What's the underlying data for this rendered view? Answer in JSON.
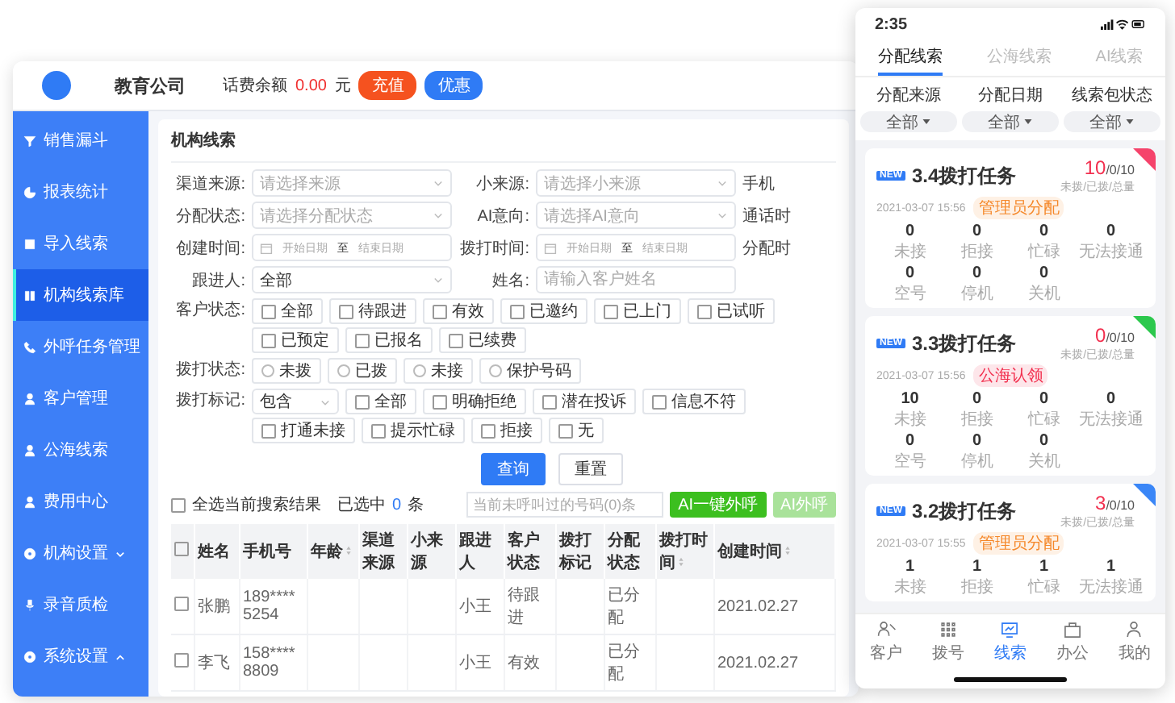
{
  "header": {
    "company": "教育公司",
    "balance_label": "话费余额",
    "balance": "0.00",
    "currency": "元",
    "buttons": [
      {
        "label": "充值",
        "kind": "recharge"
      },
      {
        "label": "优惠",
        "kind": "promo"
      }
    ]
  },
  "sidebar": {
    "items": [
      {
        "label": "销售漏斗",
        "selected": false
      },
      {
        "label": "报表统计",
        "selected": false
      },
      {
        "label": "导入线索",
        "selected": false
      },
      {
        "label": "机构线索库",
        "selected": true
      },
      {
        "label": "外呼任务管理",
        "selected": false
      },
      {
        "label": "客户管理",
        "selected": false
      },
      {
        "label": "公海线索",
        "selected": false
      },
      {
        "label": "费用中心",
        "selected": false
      },
      {
        "label": "机构设置",
        "selected": false,
        "expanded": false
      },
      {
        "label": "录音质检",
        "selected": false
      },
      {
        "label": "系统设置",
        "selected": false,
        "expanded": true
      }
    ]
  },
  "panel": {
    "title": "机构线索",
    "fields": [
      [
        {
          "label": "渠道来源:",
          "kind": "select",
          "placeholder": "请选择来源"
        },
        {
          "label": "小来源:",
          "kind": "select",
          "placeholder": "请选择小来源"
        },
        {
          "label": "手机",
          "kind": "cut"
        }
      ],
      [
        {
          "label": "分配状态:",
          "kind": "select",
          "placeholder": "请选择分配状态"
        },
        {
          "label": "AI意向:",
          "kind": "select",
          "placeholder": "请选择AI意向"
        },
        {
          "label": "通话时",
          "kind": "cut"
        }
      ],
      [
        {
          "label": "创建时间:",
          "kind": "date",
          "start": "开始日期",
          "sep": "至",
          "end": "结束日期"
        },
        {
          "label": "拨打时间:",
          "kind": "date",
          "start": "开始日期",
          "sep": "至",
          "end": "结束日期"
        },
        {
          "label": "分配时",
          "kind": "cut"
        }
      ],
      [
        {
          "label": "跟进人:",
          "kind": "select",
          "value": "全部"
        },
        {
          "label": "姓名:",
          "kind": "input",
          "placeholder": "请输入客户姓名"
        }
      ]
    ],
    "options": [
      {
        "label": "客户状态:",
        "kind": "checkbox",
        "options": [
          {
            "label": "全部",
            "checked": false
          },
          {
            "label": "待跟进",
            "checked": false
          },
          {
            "label": "有效",
            "checked": false
          },
          {
            "label": "已邀约",
            "checked": false
          },
          {
            "label": "已上门",
            "checked": false
          },
          {
            "label": "已试听",
            "checked": false
          },
          {
            "label": "已预定",
            "checked": false
          },
          {
            "label": "已报名",
            "checked": false
          },
          {
            "label": "已续费",
            "checked": false
          }
        ]
      },
      {
        "label": "拨打状态:",
        "kind": "radio",
        "options": [
          {
            "label": "未拨",
            "selected": false
          },
          {
            "label": "已拨",
            "selected": false
          },
          {
            "label": "未接",
            "selected": false
          },
          {
            "label": "保护号码",
            "selected": false
          }
        ]
      },
      {
        "label": "拨打标记:",
        "kind": "checkbox",
        "select": "包含",
        "options": [
          {
            "label": "全部",
            "checked": false
          },
          {
            "label": "明确拒绝",
            "checked": false
          },
          {
            "label": "潜在投诉",
            "checked": false
          },
          {
            "label": "信息不符",
            "checked": false
          },
          {
            "label": "打通未接",
            "checked": false
          },
          {
            "label": "提示忙碌",
            "checked": false
          },
          {
            "label": "拒接",
            "checked": false
          },
          {
            "label": "无",
            "checked": false
          }
        ]
      }
    ],
    "actions": [
      {
        "label": "查询",
        "kind": "primary"
      },
      {
        "label": "重置",
        "kind": "default"
      }
    ],
    "selection": {
      "checked": false,
      "label": "全选当前搜索结果",
      "count_label": "已选中",
      "count": "0",
      "unit": "条"
    },
    "call_tools": {
      "placeholder": "当前未呼叫过的号码(0)条",
      "buttons": [
        {
          "label": "AI一键外呼",
          "disabled": false
        },
        {
          "label": "AI外呼",
          "disabled": true
        }
      ]
    },
    "table": {
      "all_checked": false,
      "columns": [
        {
          "label": "姓名",
          "sortable": false
        },
        {
          "label": "手机号",
          "sortable": false
        },
        {
          "label": "年龄",
          "sortable": true
        },
        {
          "label": "渠道来源",
          "sortable": false
        },
        {
          "label": "小来源",
          "sortable": false
        },
        {
          "label": "跟进人",
          "sortable": false
        },
        {
          "label": "客户状态",
          "sortable": false
        },
        {
          "label": "拨打标记",
          "sortable": false
        },
        {
          "label": "分配状态",
          "sortable": false
        },
        {
          "label": "拨打时间",
          "sortable": true
        },
        {
          "label": "创建时间",
          "sortable": true
        }
      ],
      "rows": [
        {
          "checked": false,
          "cells": [
            "张鹏",
            "189****5254",
            "",
            "",
            "",
            "小王",
            "待跟进",
            "",
            "已分配",
            "",
            "2021.02.27"
          ]
        },
        {
          "checked": false,
          "cells": [
            "李飞",
            "158****8809",
            "",
            "",
            "",
            "小王",
            "有效",
            "",
            "已分配",
            "",
            "2021.02.27"
          ]
        }
      ]
    }
  },
  "phone": {
    "time": "2:35",
    "tabs": [
      {
        "label": "分配线索",
        "selected": true
      },
      {
        "label": "公海线索",
        "selected": false
      },
      {
        "label": "AI线索",
        "selected": false
      }
    ],
    "filters": [
      {
        "label": "分配来源",
        "value": "全部"
      },
      {
        "label": "分配日期",
        "value": "全部"
      },
      {
        "label": "线索包状态",
        "value": "全部"
      }
    ],
    "cards": [
      {
        "badge": "NEW",
        "title": "3.4拨打任务",
        "done": "10",
        "rest": "/0/10",
        "legend": "未拨/已拨/总量",
        "date": "2021-03-07 15:56",
        "tag": {
          "label": "管理员分配",
          "color": "#f5882a"
        },
        "color": "#f5436b",
        "stats": [
          {
            "value": "0",
            "label": "未接"
          },
          {
            "value": "0",
            "label": "拒接"
          },
          {
            "value": "0",
            "label": "忙碌"
          },
          {
            "value": "0",
            "label": "无法接通"
          },
          {
            "value": "0",
            "label": "空号"
          },
          {
            "value": "0",
            "label": "停机"
          },
          {
            "value": "0",
            "label": "关机"
          }
        ]
      },
      {
        "badge": "NEW",
        "title": "3.3拨打任务",
        "done": "0",
        "rest": "/0/10",
        "legend": "未拨/已拨/总量",
        "date": "2021-03-07 15:56",
        "tag": {
          "label": "公海认领",
          "color": "#f2304f"
        },
        "color": "#2cc84d",
        "stats": [
          {
            "value": "10",
            "label": "未接"
          },
          {
            "value": "0",
            "label": "拒接"
          },
          {
            "value": "0",
            "label": "忙碌"
          },
          {
            "value": "0",
            "label": "无法接通"
          },
          {
            "value": "0",
            "label": "空号"
          },
          {
            "value": "0",
            "label": "停机"
          },
          {
            "value": "0",
            "label": "关机"
          }
        ]
      },
      {
        "badge": "NEW",
        "title": "3.2拨打任务",
        "done": "3",
        "rest": "/0/10",
        "legend": "未拨/已拨/总量",
        "date": "2021-03-07 15:55",
        "tag": {
          "label": "管理员分配",
          "color": "#f5882a"
        },
        "color": "#3a86f7",
        "stats": [
          {
            "value": "1",
            "label": "未接"
          },
          {
            "value": "1",
            "label": "拒接"
          },
          {
            "value": "1",
            "label": "忙碌"
          },
          {
            "value": "1",
            "label": "无法接通"
          }
        ]
      }
    ],
    "nav": [
      {
        "label": "客户",
        "selected": false
      },
      {
        "label": "拨号",
        "selected": false
      },
      {
        "label": "线索",
        "selected": true
      },
      {
        "label": "办公",
        "selected": false
      },
      {
        "label": "我的",
        "selected": false
      }
    ]
  }
}
